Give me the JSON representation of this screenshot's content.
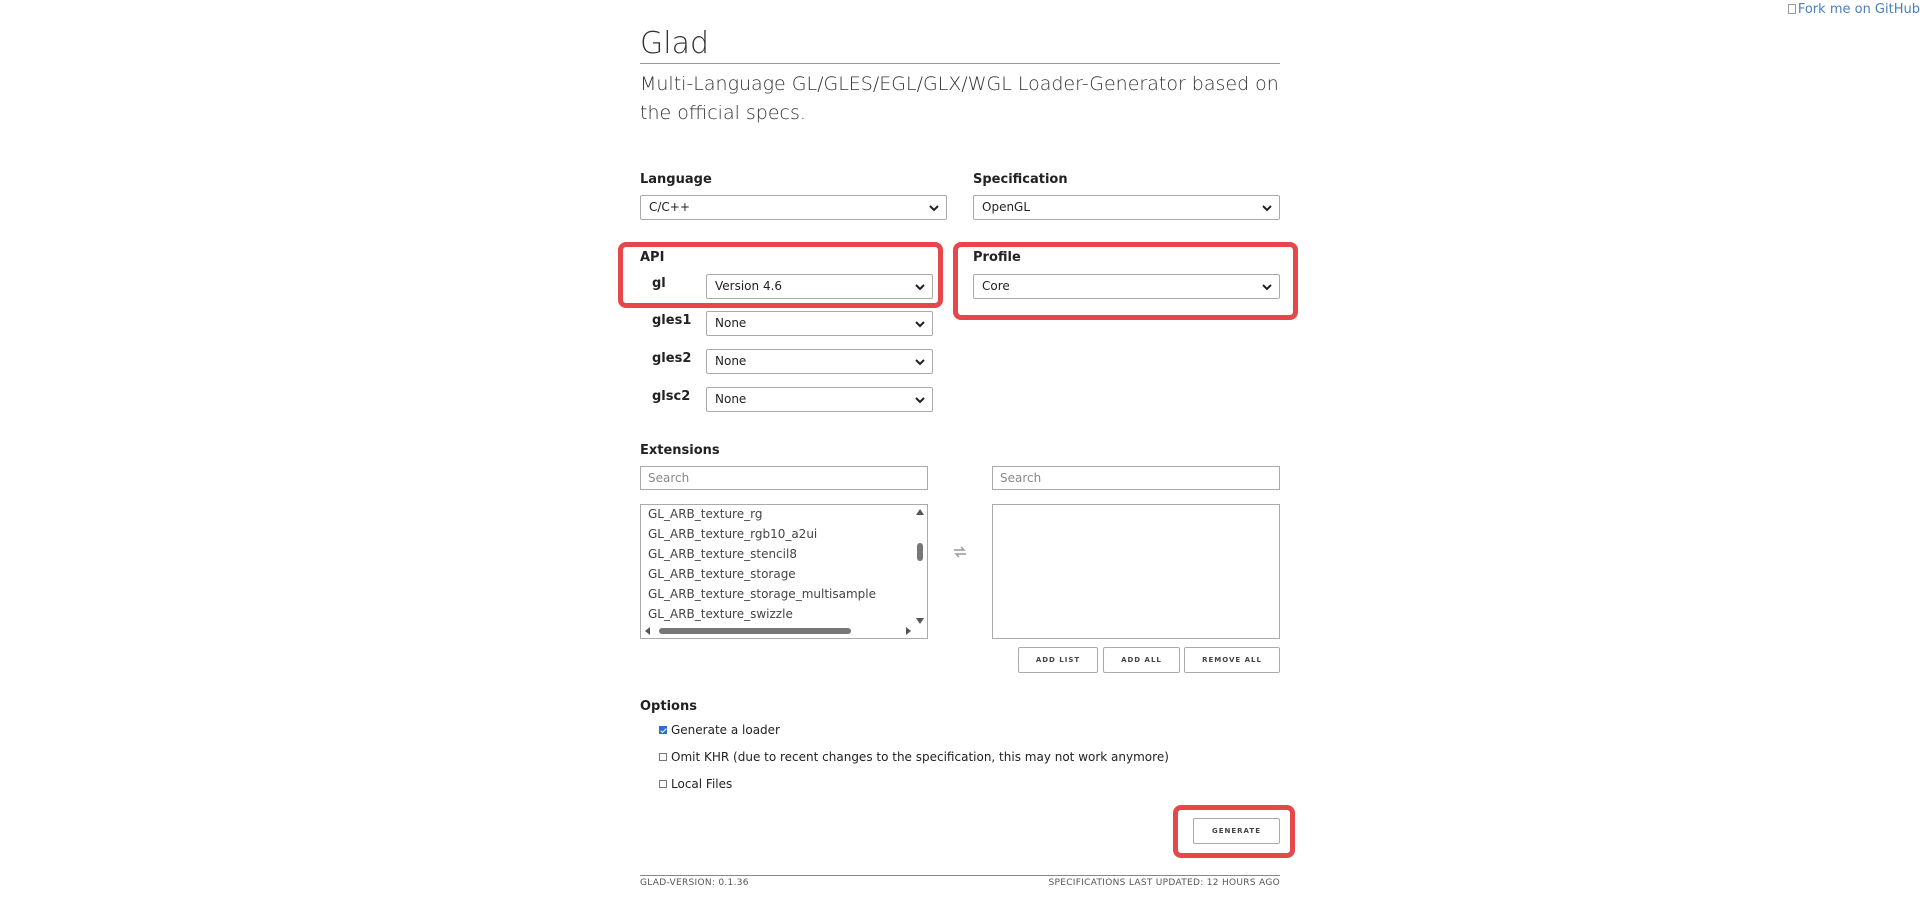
{
  "fork": {
    "alt_text": "Fork me on GitHub"
  },
  "header": {
    "title": "Glad",
    "subtitle": "Multi-Language GL/GLES/EGL/GLX/WGL Loader-Generator based on the official specs."
  },
  "language": {
    "label": "Language",
    "value": "C/C++"
  },
  "specification": {
    "label": "Specification",
    "value": "OpenGL"
  },
  "api": {
    "label": "API",
    "rows": [
      {
        "name": "gl",
        "value": "Version 4.6"
      },
      {
        "name": "gles1",
        "value": "None"
      },
      {
        "name": "gles2",
        "value": "None"
      },
      {
        "name": "glsc2",
        "value": "None"
      }
    ]
  },
  "profile": {
    "label": "Profile",
    "value": "Core"
  },
  "extensions": {
    "label": "Extensions",
    "left_search_placeholder": "Search",
    "right_search_placeholder": "Search",
    "available": [
      "GL_ARB_texture_rg",
      "GL_ARB_texture_rgb10_a2ui",
      "GL_ARB_texture_stencil8",
      "GL_ARB_texture_storage",
      "GL_ARB_texture_storage_multisample",
      "GL_ARB_texture_swizzle"
    ],
    "buttons": {
      "add_list": "ADD LIST",
      "add_all": "ADD ALL",
      "remove_all": "REMOVE ALL"
    },
    "swap_icon": "swap-arrows-icon"
  },
  "options": {
    "label": "Options",
    "items": [
      {
        "label": "Generate a loader",
        "checked": true
      },
      {
        "label": "Omit KHR (due to recent changes to the specification, this may not work anymore)",
        "checked": false
      },
      {
        "label": "Local Files",
        "checked": false
      }
    ]
  },
  "generate": {
    "label": "GENERATE"
  },
  "footer": {
    "version": "GLAD-VERSION: 0.1.36",
    "updated": "SPECIFICATIONS LAST UPDATED: 12 HOURS AGO"
  },
  "colors": {
    "highlight": "#e5474b",
    "link": "#4a7fbf"
  }
}
